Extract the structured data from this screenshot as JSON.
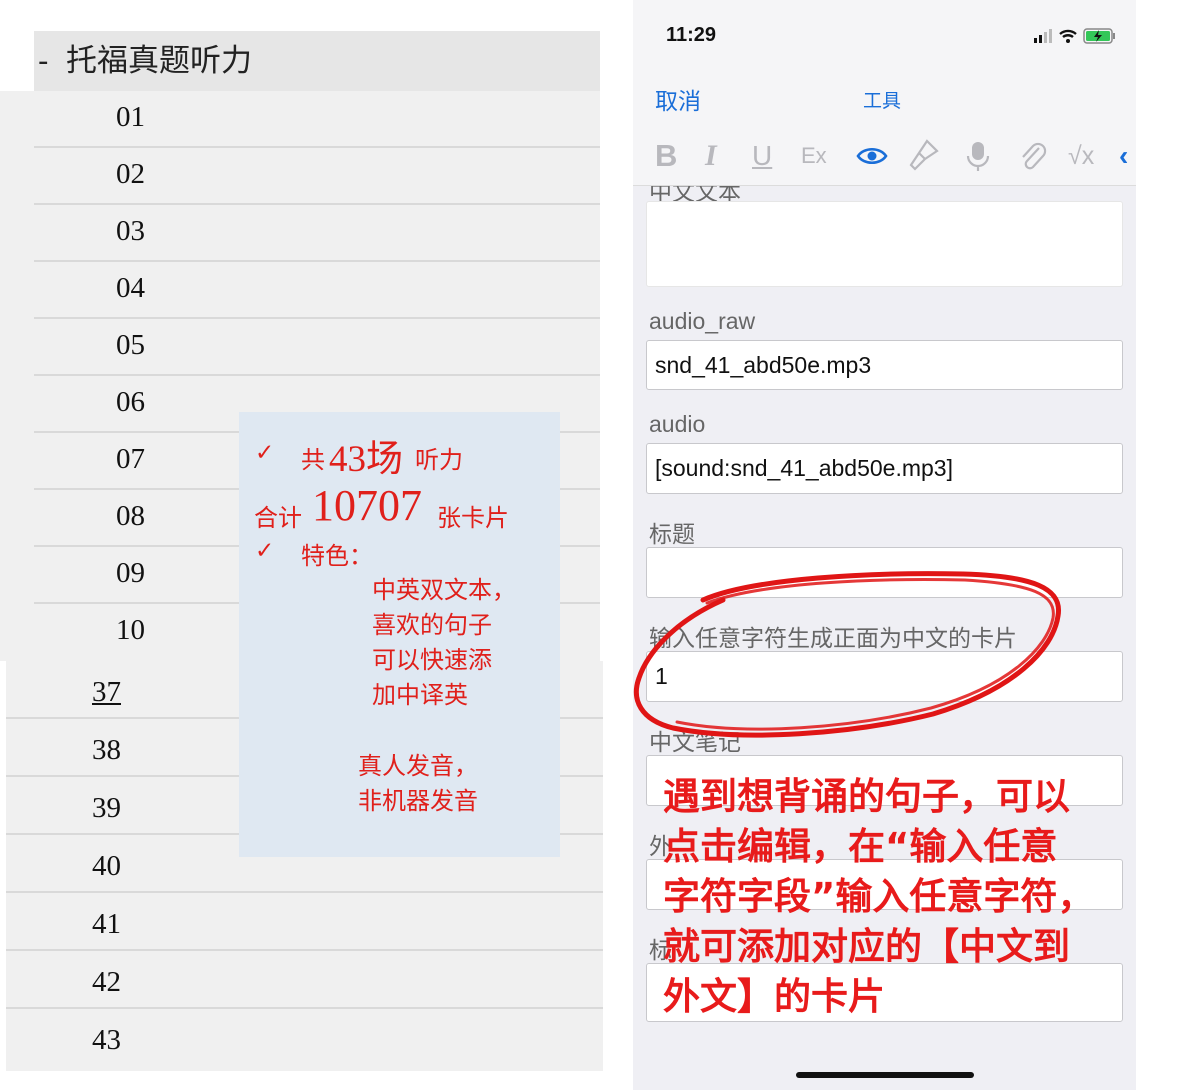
{
  "deck": {
    "header_dash": "-",
    "header_title": "托福真题听力",
    "sub_items": [
      "01",
      "02",
      "03",
      "04",
      "05",
      "06",
      "07",
      "08",
      "09",
      "10"
    ],
    "items": [
      "37",
      "38",
      "39",
      "40",
      "41",
      "42",
      "43"
    ]
  },
  "note": {
    "check": "✓",
    "line1_a": "共",
    "line1_b": "43场",
    "line1_c": "听力",
    "line2_a": "合计",
    "line2_b": "10707",
    "line2_c": "张卡片",
    "line3": "特色：",
    "f1": "中英双文本，",
    "f2": "喜欢的句子",
    "f3": "可以快速添",
    "f4": "加中译英",
    "f5": "真人发音，",
    "f6": "非机器发音"
  },
  "phone": {
    "time": "11:29",
    "cancel": "取消",
    "title": "工具",
    "toolbar": {
      "bold": "B",
      "italic": "I",
      "underline": "U",
      "clear": "Ex",
      "math": "√x"
    },
    "fields": {
      "chinese_text_label": "中文文本",
      "audio_raw_label": "audio_raw",
      "audio_raw_value": "snd_41_abd50e.mp3",
      "audio_label": "audio",
      "audio_value": "[sound:snd_41_abd50e.mp3]",
      "title_label": "标题",
      "any_char_label": "输入任意字符生成正面为中文的卡片",
      "any_char_value": "1",
      "cn_note_label": "中文笔记",
      "fw_label": "外",
      "tag_label": "标"
    },
    "overlay": {
      "l1": "遇到想背诵的句子，可以",
      "l2": "点击编辑，在“输入任意",
      "l3": "字符字段”输入任意字符，",
      "l4": "就可添加对应的【中文到",
      "l5": "外文】的卡片"
    },
    "colors": {
      "accent": "#1a6ed8",
      "annotation": "#e81b1b"
    }
  }
}
